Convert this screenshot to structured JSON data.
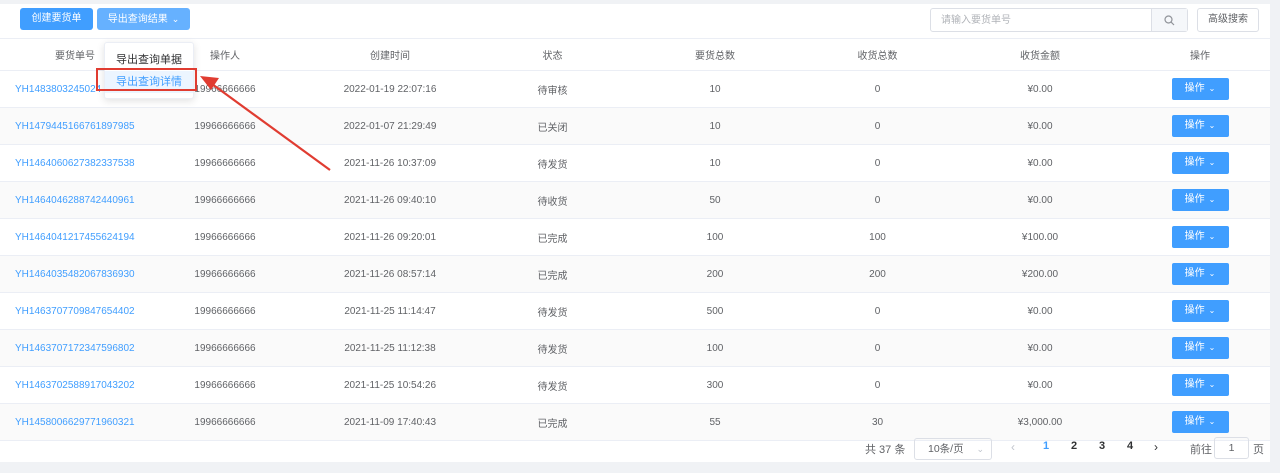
{
  "toolbar": {
    "create_label": "创建要货单",
    "export_label": "导出查询结果",
    "search_placeholder": "请输入要货单号",
    "advanced_label": "高级搜索"
  },
  "export_menu": {
    "item1": "导出查询单据",
    "item2": "导出查询详情"
  },
  "columns": [
    "要货单号",
    "操作人",
    "创建时间",
    "状态",
    "要货总数",
    "收货总数",
    "收货金额",
    "操作"
  ],
  "rows": [
    {
      "order": "YH1483803245024",
      "operator": "19966666666",
      "created": "2022-01-19 22:07:16",
      "status": "待审核",
      "qty": "10",
      "received": "0",
      "amount": "¥0.00"
    },
    {
      "order": "YH1479445166761897985",
      "operator": "19966666666",
      "created": "2022-01-07 21:29:49",
      "status": "已关闭",
      "qty": "10",
      "received": "0",
      "amount": "¥0.00"
    },
    {
      "order": "YH1464060627382337538",
      "operator": "19966666666",
      "created": "2021-11-26 10:37:09",
      "status": "待发货",
      "qty": "10",
      "received": "0",
      "amount": "¥0.00"
    },
    {
      "order": "YH1464046288742440961",
      "operator": "19966666666",
      "created": "2021-11-26 09:40:10",
      "status": "待收货",
      "qty": "50",
      "received": "0",
      "amount": "¥0.00"
    },
    {
      "order": "YH1464041217455624194",
      "operator": "19966666666",
      "created": "2021-11-26 09:20:01",
      "status": "已完成",
      "qty": "100",
      "received": "100",
      "amount": "¥100.00"
    },
    {
      "order": "YH1464035482067836930",
      "operator": "19966666666",
      "created": "2021-11-26 08:57:14",
      "status": "已完成",
      "qty": "200",
      "received": "200",
      "amount": "¥200.00"
    },
    {
      "order": "YH1463707709847654402",
      "operator": "19966666666",
      "created": "2021-11-25 11:14:47",
      "status": "待发货",
      "qty": "500",
      "received": "0",
      "amount": "¥0.00"
    },
    {
      "order": "YH1463707172347596802",
      "operator": "19966666666",
      "created": "2021-11-25 11:12:38",
      "status": "待发货",
      "qty": "100",
      "received": "0",
      "amount": "¥0.00"
    },
    {
      "order": "YH1463702588917043202",
      "operator": "19966666666",
      "created": "2021-11-25 10:54:26",
      "status": "待发货",
      "qty": "300",
      "received": "0",
      "amount": "¥0.00"
    },
    {
      "order": "YH1458006629771960321",
      "operator": "19966666666",
      "created": "2021-11-09 17:40:43",
      "status": "已完成",
      "qty": "55",
      "received": "30",
      "amount": "¥3,000.00"
    }
  ],
  "row_action_label": "操作",
  "pagination": {
    "total": "共 37 条",
    "page_size": "10条/页",
    "pages": [
      "1",
      "2",
      "3",
      "4"
    ],
    "current": "1",
    "goto_label": "前往",
    "goto_value": "1",
    "goto_suffix": "页"
  },
  "colors": {
    "primary": "#409eff",
    "annotation": "#e03c31"
  }
}
